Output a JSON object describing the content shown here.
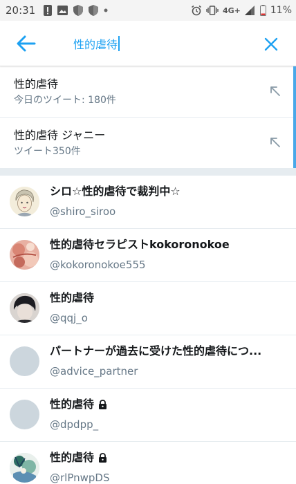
{
  "status_bar": {
    "time": "20:31",
    "network": "4G+",
    "battery": "11%"
  },
  "search": {
    "query": "性的虐待"
  },
  "suggestions": [
    {
      "title": "性的虐待",
      "subtitle": "今日のツイート: 180件"
    },
    {
      "title": "性的虐待 ジャニー",
      "subtitle": "ツイート350件"
    }
  ],
  "users": [
    {
      "name": "シロ☆性的虐待で裁判中☆",
      "handle": "@shiro_siroo",
      "avatar": "drawn-portrait",
      "protected": false
    },
    {
      "name": "性的虐待セラピストkokoronokoe",
      "handle": "@kokoronokoe555",
      "avatar": "pink-photo",
      "protected": false
    },
    {
      "name": "性的虐待",
      "handle": "@qqj_o",
      "avatar": "dark-photo",
      "protected": false
    },
    {
      "name": "パートナーが過去に受けた性的虐待につ...",
      "handle": "@advice_partner",
      "avatar": "default",
      "protected": false
    },
    {
      "name": "性的虐待",
      "handle": "@dpdpp_",
      "avatar": "default",
      "protected": true
    },
    {
      "name": "性的虐待",
      "handle": "@rlPnwpDS",
      "avatar": "green-art",
      "protected": true
    }
  ],
  "colors": {
    "accent": "#1da1f2",
    "secondary_text": "#657786",
    "divider": "#e6ecf0"
  }
}
